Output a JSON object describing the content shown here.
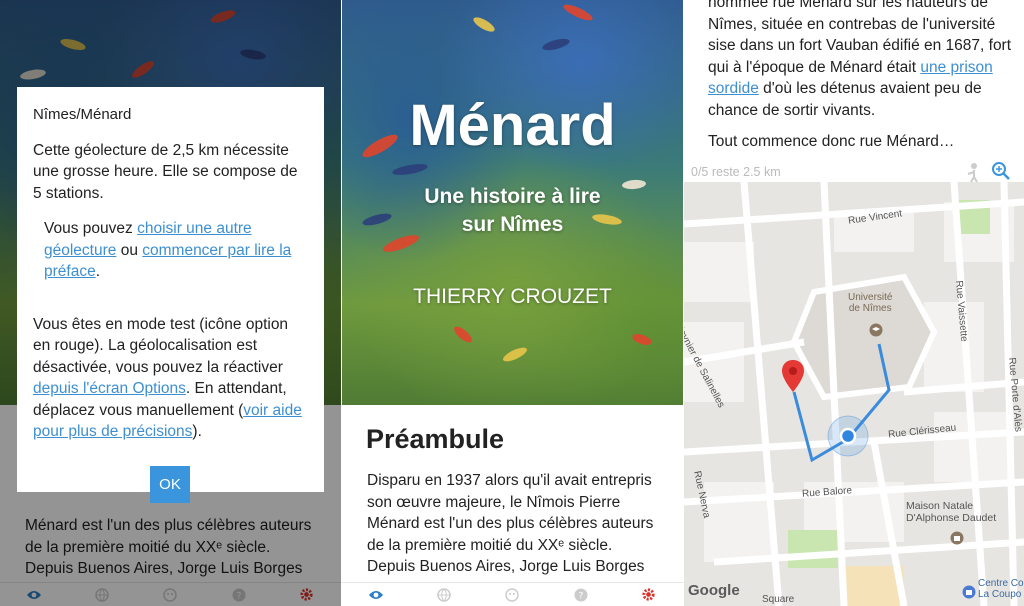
{
  "panel1": {
    "dialog": {
      "title": "Nîmes/Ménard",
      "intro": "Cette géolecture de 2,5 km nécessite une grosse heure. Elle se compose de 5 stations.",
      "choice_prefix": "Vous pouvez ",
      "choice_link1": "choisir une autre géolecture",
      "choice_mid": " ou ",
      "choice_link2": "commencer par lire la préface",
      "choice_suffix": ".",
      "test_text": "Vous êtes en mode test (icône option en rouge). La géolocalisation est désactivée, vous pouvez la réactiver ",
      "test_link": "depuis l'écran Options",
      "test_mid": ". En attendant, déplacez vous manuellement (",
      "help_link": "voir aide pour plus de précisions",
      "test_end": ").",
      "ok_label": "OK"
    },
    "body_text": "Ménard est l'un des plus célèbres auteurs de la première moitié du XXᵉ siècle. Depuis Buenos Aires, Jorge Luis Borges"
  },
  "panel2": {
    "cover_title": "Ménard",
    "cover_subtitle_line1": "Une histoire à lire",
    "cover_subtitle_line2": "sur Nîmes",
    "author": "THIERRY CROUZET",
    "section_title": "Préambule",
    "body_text": "Disparu en 1937 alors qu'il avait entrepris son œuvre majeure, le Nîmois Pierre Ménard est l'un des plus célèbres auteurs de la première moitié du XXᵉ siècle. Depuis Buenos Aires, Jorge Luis Borges"
  },
  "panel3": {
    "line0": "nommée rue Ménard sur les hauteurs de",
    "para1_a": "Nîmes, située en contrebas de l'université sise dans un fort Vauban édifié en 1687, fort qui à l'époque de Ménard était ",
    "para1_link": "une prison sordide",
    "para1_b": " d'où les détenus avaient peu de chance de sortir vivants.",
    "para2": "Tout commence donc rue Ménard…",
    "status": "0/5 reste 2.5 km",
    "map_labels": {
      "rue_vincent": "Rue Vincent",
      "rue_meynier": "Rue Meynier de Salinelles",
      "universite": "Université\nde Nîmes",
      "rue_vaissette": "Rue Vaissette",
      "rue_porte": "Rue Porte d'Alès",
      "rue_clerisseau": "Rue Clérisseau",
      "rue_nerva": "Rue Nerva",
      "rue_balore": "Rue Balore",
      "maison": "Maison Natale\nD'Alphonse Daudet",
      "google": "Google",
      "square": "Square",
      "centre": "Centre Co\nLa Coupo"
    }
  },
  "tabbar": {
    "icons": [
      "eye-icon",
      "globe-icon",
      "face-icon",
      "help-icon",
      "gear-icon"
    ]
  },
  "colors": {
    "link": "#3d8fd1",
    "ok_button": "#3a95dd",
    "tab_active": "#2a7fc6",
    "gear_test": "#d9322b",
    "route": "#3b8bdc",
    "pin": "#e53935"
  }
}
